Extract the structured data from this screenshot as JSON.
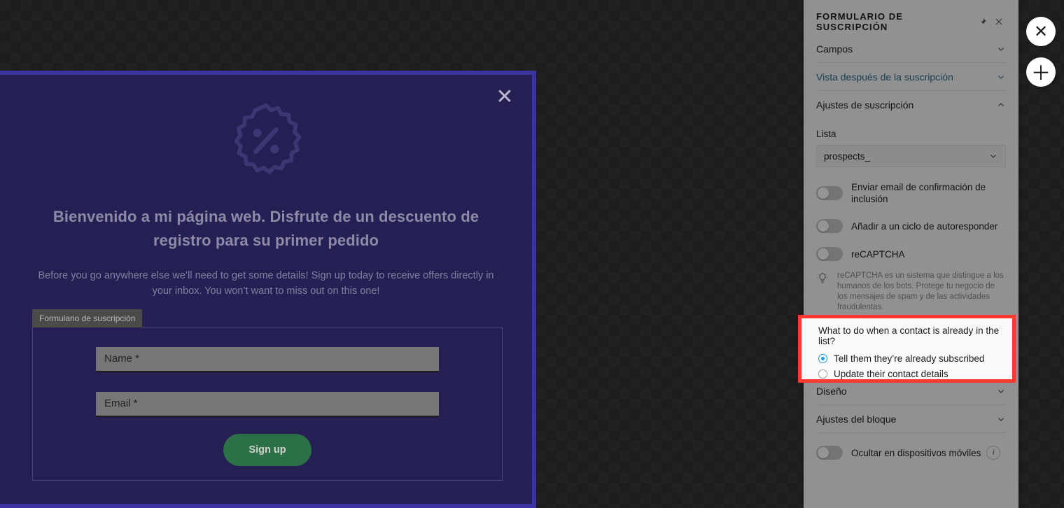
{
  "popup": {
    "close_icon": "close-icon",
    "badge_icon": "discount-percent-badge-icon",
    "heading": "Bienvenido a mi página web. Disfrute de un descuento de registro para su primer pedido",
    "subheading": "Before you go anywhere else we’ll need to get some details! Sign up today to receive offers directly in your inbox. You won’t want to miss out on this one!",
    "form": {
      "tag_label": "Formulario de suscripción",
      "name_placeholder": "Name *",
      "name_value": "",
      "email_placeholder": "Email *",
      "email_value": "",
      "submit_label": "Sign up",
      "submit_color": "#2b7046"
    }
  },
  "sidebar": {
    "title": "FORMULARIO DE SUSCRIPCIÓN",
    "pin_icon": "pin-icon",
    "close_icon": "close-icon",
    "sections": {
      "campos": "Campos",
      "vista": "Vista después de la suscripción",
      "vista_color": "#2d6a8e",
      "ajustes_suscripcion": "Ajustes de suscripción",
      "diseno": "Diseño",
      "ajustes_bloque": "Ajustes del bloque"
    },
    "list": {
      "label": "Lista",
      "value": "prospects_",
      "chevron_icon": "chevron-down-icon"
    },
    "toggles": {
      "confirm_email": "Enviar email de confirmación de inclusión",
      "autoresponder": "Añadir a un ciclo de autoresponder",
      "recaptcha": "reCAPTCHA",
      "hide_mobile": "Ocultar en dispositivos móviles"
    },
    "hint": {
      "icon": "lightbulb-icon",
      "text": "reCAPTCHA es un sistema que distingue a los humanos de los bots. Protege tu negocio de los mensajes de spam y de las actividades fraudulentas."
    },
    "highlight": {
      "border_color": "#ff3b30",
      "question": "What to do when a contact is already in the list?",
      "options": [
        {
          "label": "Tell them they’re already subscribed",
          "selected": true
        },
        {
          "label": "Update their contact details",
          "selected": false
        }
      ],
      "accent_color": "#1a9bf0"
    },
    "info_badge": "i"
  },
  "rail": {
    "close_label": "✕",
    "add_label": "＋"
  }
}
